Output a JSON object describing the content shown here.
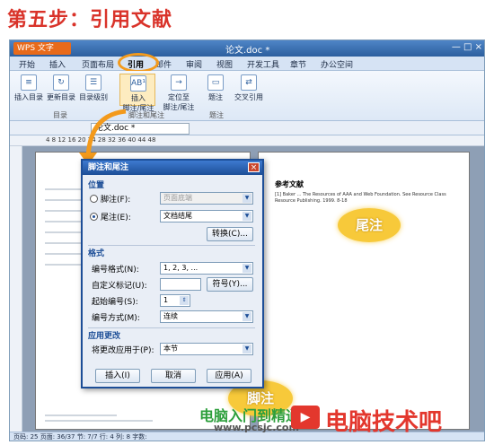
{
  "step_title": "第五步：引用文献",
  "window": {
    "app_name": "WPS 文字",
    "doc_title": "论文.doc *",
    "controls": "— □ ×"
  },
  "menu": [
    "开始",
    "插入",
    "页面布局",
    "引用",
    "邮件",
    "审阅",
    "视图",
    "开发工具",
    "章节",
    "办公空间"
  ],
  "menu_active": "引用",
  "ribbon": {
    "buttons": [
      "插入目录",
      "更新目录",
      "目录级别",
      "插入\n脚注/尾注",
      "定位至\n脚注/尾注",
      "题注",
      "交叉引用"
    ],
    "groups": [
      "目录",
      "脚注和尾注",
      "题注"
    ]
  },
  "doc_tab": "论文.doc *",
  "ruler_marks": "4   8   12  16  20  24  28  32  36  40  44  48",
  "status_bar": "页码: 25  页面: 36/37  节: 7/7  行: 4  列: 8  字数:",
  "right_page": {
    "heading": "参考文献",
    "ref_text": "[1] Baker ... The Resources of AAA and Web Foundation. See Resource Class Resource Publishing. 1999. 8-18"
  },
  "dialog": {
    "title": "脚注和尾注",
    "close": "×",
    "position_section": "位置",
    "footnote_label": "脚注(F):",
    "footnote_value": "页面底端",
    "endnote_label": "尾注(E):",
    "endnote_value": "文档结尾",
    "convert_button": "转换(C)...",
    "format_section": "格式",
    "number_format_label": "编号格式(N):",
    "number_format_value": "1, 2, 3, ...",
    "custom_mark_label": "自定义标记(U):",
    "custom_mark_value": "",
    "symbol_button": "符号(Y)...",
    "start_label": "起始编号(S):",
    "start_value": "1",
    "numbering_label": "编号方式(M):",
    "numbering_value": "连续",
    "apply_section": "应用更改",
    "apply_to_label": "将更改应用于(P):",
    "apply_to_value": "本节",
    "insert_button": "插入(I)",
    "cancel_button": "取消",
    "apply_button": "应用(A)"
  },
  "callouts": {
    "endnote": "尾注",
    "footnote": "脚注"
  },
  "watermark": {
    "green_text": "电脑入门到精通网",
    "url": "www.pcsjc.com",
    "red_text": "电脑技术吧"
  },
  "colors": {
    "title_red": "#d9332a",
    "highlight_orange": "#f39a1c",
    "callout_yellow": "#f7c93a",
    "dialog_blue": "#1d4e97"
  }
}
